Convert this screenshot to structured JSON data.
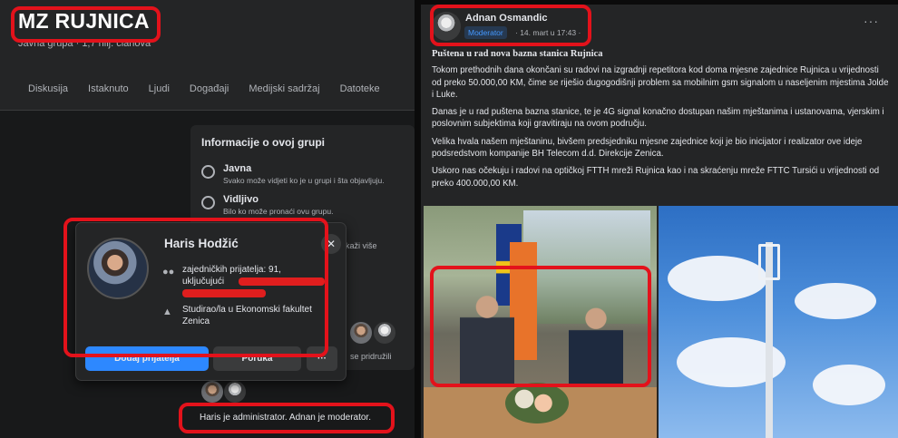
{
  "group": {
    "title": "MZ RUJNICA",
    "subtitle": "Javna grupa · 1,7 hilj. članova",
    "tabs": [
      "Diskusija",
      "Istaknuto",
      "Ljudi",
      "Događaji",
      "Medijski sadržaj",
      "Datoteke"
    ]
  },
  "info": {
    "title": "Informacije o ovoj grupi",
    "public_title": "Javna",
    "public_text": "Svako može vidjeti ko je u grupi i šta objavljuju.",
    "visible_title": "Vidljivo",
    "visible_text": "Bilo ko može pronaći ovu grupu.",
    "see_more": "Prikaži više"
  },
  "profile_popup": {
    "name": "Haris Hodžić",
    "mutual_friends": "zajedničkih prijatelja: 91,",
    "including": "uključujući",
    "education": "Studirao/la u Ekonomski fakultet Zenica",
    "add_friend": "Dodaj prijatelja",
    "message": "Poruka",
    "more": "···",
    "close": "✕"
  },
  "joined_text": "se pridružili",
  "admin_text": "Haris je administrator. Adnan je moderator.",
  "post": {
    "author": "Adnan Osmandic",
    "badge": "Moderator",
    "date": "· 14. mart u 17:43 · ",
    "menu": "···",
    "headline": "Puštena u rad nova bazna stanica Rujnica",
    "p1": "Tokom prethodnih dana okončani su radovi na izgradnji repetitora kod doma mjesne zajednice Rujnica u vrijednosti od preko 50.000,00 KM, čime se riješio dugogodišnji problem sa mobilnim gsm signalom u naseljenim mjestima Jolde i Luke.",
    "p2": "Danas je u rad puštena bazna stanice, te je 4G signal konačno dostupan našim mještanima i ustanovama, vjerskim i poslovnim subjektima koji gravitiraju na ovom području.",
    "p3": "Velika hvala našem mještaninu, bivšem predsjedniku mjesne zajednice koji je bio inicijator i realizator ove ideje podsredstvom kompanije BH Telecom d.d. Direkcije Zenica.",
    "p4": "Uskoro nas očekuju i radovi na optičkoj FTTH mreži Rujnica kao i na skraćenju mreže FTTC Tursići u vrijednosti od preko 400.000,00 KM."
  },
  "colors": {
    "annotation_red": "#e3121b",
    "fb_blue": "#2d88ff",
    "dark_bg": "#18191a",
    "card_bg": "#242526"
  }
}
